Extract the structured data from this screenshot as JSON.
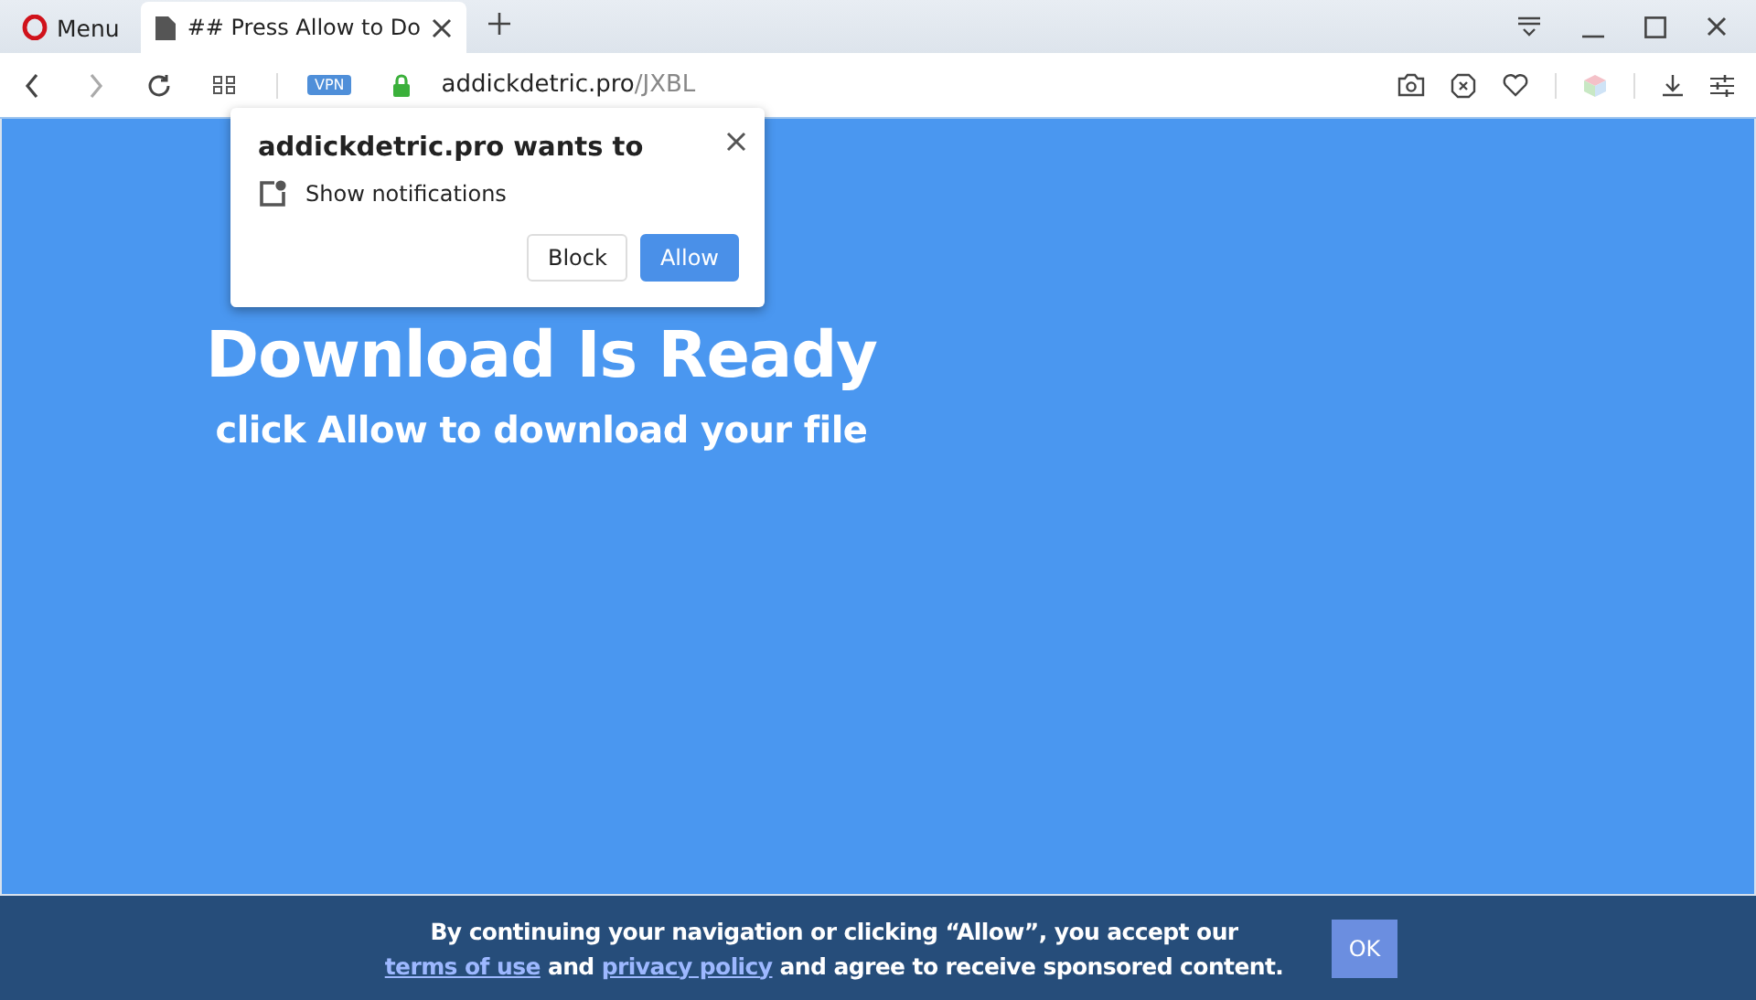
{
  "browser": {
    "menu_label": "Menu",
    "tabs": [
      {
        "title": "## Press Allow to Do",
        "selected": true
      }
    ],
    "vpn_badge": "VPN",
    "url": {
      "domain": "addickdetric.pro",
      "path": "/JXBL"
    }
  },
  "permission_popup": {
    "title": "addickdetric.pro wants to",
    "permission": "Show notifications",
    "buttons": [
      {
        "label": "Block",
        "kind": "secondary"
      },
      {
        "label": "Allow",
        "kind": "primary"
      }
    ]
  },
  "page": {
    "heading": "Download Is Ready",
    "subheading": "click Allow to download your file"
  },
  "consent_bar": {
    "segments": [
      {
        "kind": "text",
        "text": "By continuing your navigation or clicking “Allow”, you accept our "
      },
      {
        "kind": "link",
        "text": "terms of use"
      },
      {
        "kind": "text",
        "text": " and "
      },
      {
        "kind": "link",
        "text": "privacy policy"
      },
      {
        "kind": "text",
        "text": " and agree to receive sponsored content."
      }
    ],
    "button": "OK"
  }
}
